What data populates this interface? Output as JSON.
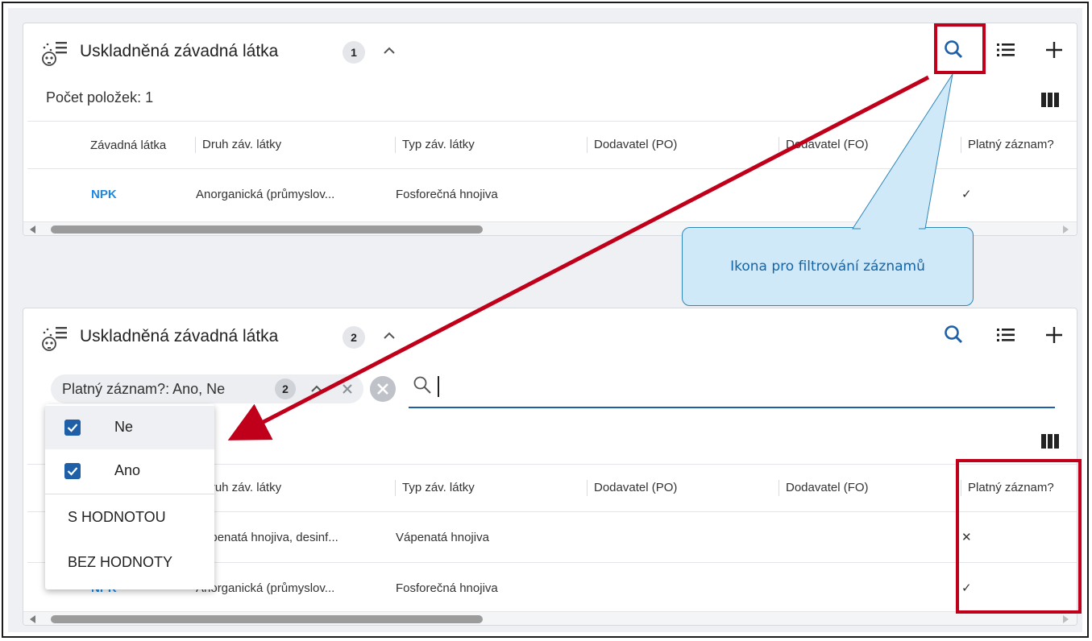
{
  "colors": {
    "accent": "#1e5fa8",
    "link": "#1e88e5",
    "highlight": "#c0001a",
    "callout_bg": "#cfe9f8",
    "callout_text": "#1565a6"
  },
  "section1": {
    "title": "Uskladněná závadná látka",
    "badge": "1",
    "count_text": "Počet položek: 1",
    "icons": [
      "skull-list-icon",
      "chevron-up-icon",
      "search-icon",
      "list-icon",
      "plus-icon",
      "columns-icon"
    ],
    "columns": [
      "Závadná látka",
      "Druh záv. látky",
      "Typ záv. látky",
      "Dodavatel (PO)",
      "Dodavatel (FO)",
      "Platný záznam?"
    ],
    "rows": [
      {
        "substance": "NPK",
        "kind": "Anorganická (průmyslov...",
        "type": "Fosforečná hnojiva",
        "supplier_po": "",
        "supplier_fo": "",
        "valid": "✓"
      }
    ]
  },
  "section2": {
    "title": "Uskladněná závadná látka",
    "badge": "2",
    "filter_chip": {
      "label": "Platný záznam?: Ano, Ne",
      "count": "2"
    },
    "search": {
      "value": "",
      "placeholder": ""
    },
    "columns": [
      "Druh záv. látky",
      "Typ záv. látky",
      "Dodavatel (PO)",
      "Dodavatel (FO)",
      "Platný záznam?"
    ],
    "rows": [
      {
        "substance": "",
        "kind": "Vápenatá hnojiva, desinf...",
        "type": "Vápenatá hnojiva",
        "supplier_po": "",
        "supplier_fo": "",
        "valid": "✕"
      },
      {
        "substance": "NPK",
        "kind": "Anorganická (průmyslov...",
        "type": "Fosforečná hnojiva",
        "supplier_po": "",
        "supplier_fo": "",
        "valid": "✓"
      }
    ]
  },
  "dropdown": {
    "options": [
      {
        "label": "Ne",
        "checked": true
      },
      {
        "label": "Ano",
        "checked": true
      }
    ],
    "actions": [
      "S HODNOTOU",
      "BEZ HODNOTY"
    ]
  },
  "callout": {
    "text": "Ikona pro filtrování záznamů"
  }
}
